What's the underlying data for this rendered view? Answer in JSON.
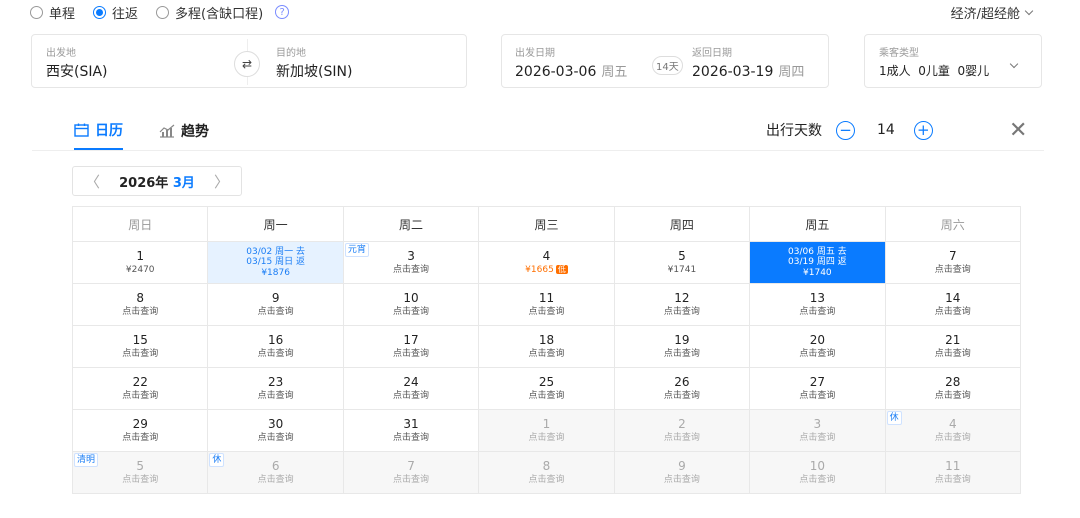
{
  "trip_types": [
    {
      "label": "单程",
      "selected": false
    },
    {
      "label": "往返",
      "selected": true
    },
    {
      "label": "多程(含缺口程)",
      "selected": false
    }
  ],
  "help_glyph": "?",
  "cabin": "经济/超经舱",
  "search": {
    "origin_label": "出发地",
    "origin_value": "西安(SIA)",
    "dest_label": "目的地",
    "dest_value": "新加坡(SIN)",
    "depart_label": "出发日期",
    "depart_date": "2026-03-06",
    "depart_weekday": "周五",
    "days_tag": "14天",
    "return_label": "返回日期",
    "return_date": "2026-03-19",
    "return_weekday": "周四",
    "pax_label": "乘客类型",
    "pax_value": "1成人  0儿童  0婴儿"
  },
  "tabs": [
    {
      "label": "日历",
      "active": true,
      "icon": "calendar-icon"
    },
    {
      "label": "趋势",
      "active": false,
      "icon": "trend-icon"
    }
  ],
  "trip_days": {
    "label": "出行天数",
    "value": "14",
    "minus": "−",
    "plus": "+"
  },
  "close_glyph": "✕",
  "month_nav": {
    "prev": "〈",
    "next": "〉",
    "year": "2026年",
    "month": "3月"
  },
  "weekdays": [
    "周日",
    "周一",
    "周二",
    "周三",
    "周四",
    "周五",
    "周六"
  ],
  "calendar": [
    {
      "day": "1",
      "sub": "¥2470"
    },
    {
      "type": "ret",
      "lines": [
        "03/02 周一 去",
        "03/15 周日 返",
        "¥1876"
      ]
    },
    {
      "day": "3",
      "sub": "点击查询",
      "tag": "元宵"
    },
    {
      "day": "4",
      "sub": "¥1665",
      "low": "低"
    },
    {
      "day": "5",
      "sub": "¥1741"
    },
    {
      "type": "dep",
      "lines": [
        "03/06 周五 去",
        "03/19 周四 返",
        "¥1740"
      ]
    },
    {
      "day": "7",
      "sub": "点击查询"
    },
    {
      "day": "8",
      "sub": "点击查询"
    },
    {
      "day": "9",
      "sub": "点击查询"
    },
    {
      "day": "10",
      "sub": "点击查询"
    },
    {
      "day": "11",
      "sub": "点击查询"
    },
    {
      "day": "12",
      "sub": "点击查询"
    },
    {
      "day": "13",
      "sub": "点击查询"
    },
    {
      "day": "14",
      "sub": "点击查询"
    },
    {
      "day": "15",
      "sub": "点击查询"
    },
    {
      "day": "16",
      "sub": "点击查询"
    },
    {
      "day": "17",
      "sub": "点击查询"
    },
    {
      "day": "18",
      "sub": "点击查询"
    },
    {
      "day": "19",
      "sub": "点击查询"
    },
    {
      "day": "20",
      "sub": "点击查询"
    },
    {
      "day": "21",
      "sub": "点击查询"
    },
    {
      "day": "22",
      "sub": "点击查询"
    },
    {
      "day": "23",
      "sub": "点击查询"
    },
    {
      "day": "24",
      "sub": "点击查询"
    },
    {
      "day": "25",
      "sub": "点击查询"
    },
    {
      "day": "26",
      "sub": "点击查询"
    },
    {
      "day": "27",
      "sub": "点击查询"
    },
    {
      "day": "28",
      "sub": "点击查询"
    },
    {
      "day": "29",
      "sub": "点击查询"
    },
    {
      "day": "30",
      "sub": "点击查询"
    },
    {
      "day": "31",
      "sub": "点击查询"
    },
    {
      "day": "1",
      "sub": "点击查询",
      "out": true
    },
    {
      "day": "2",
      "sub": "点击查询",
      "out": true
    },
    {
      "day": "3",
      "sub": "点击查询",
      "out": true
    },
    {
      "day": "4",
      "sub": "点击查询",
      "out": true,
      "tag": "休"
    },
    {
      "day": "5",
      "sub": "点击查询",
      "out": true,
      "tag": "清明"
    },
    {
      "day": "6",
      "sub": "点击查询",
      "out": true,
      "tag": "休"
    },
    {
      "day": "7",
      "sub": "点击查询",
      "out": true
    },
    {
      "day": "8",
      "sub": "点击查询",
      "out": true
    },
    {
      "day": "9",
      "sub": "点击查询",
      "out": true
    },
    {
      "day": "10",
      "sub": "点击查询",
      "out": true
    },
    {
      "day": "11",
      "sub": "点击查询",
      "out": true
    }
  ],
  "colors": {
    "accent": "#0a7bff",
    "low_price": "#ff6f00",
    "return_bg": "#e6f2ff"
  }
}
